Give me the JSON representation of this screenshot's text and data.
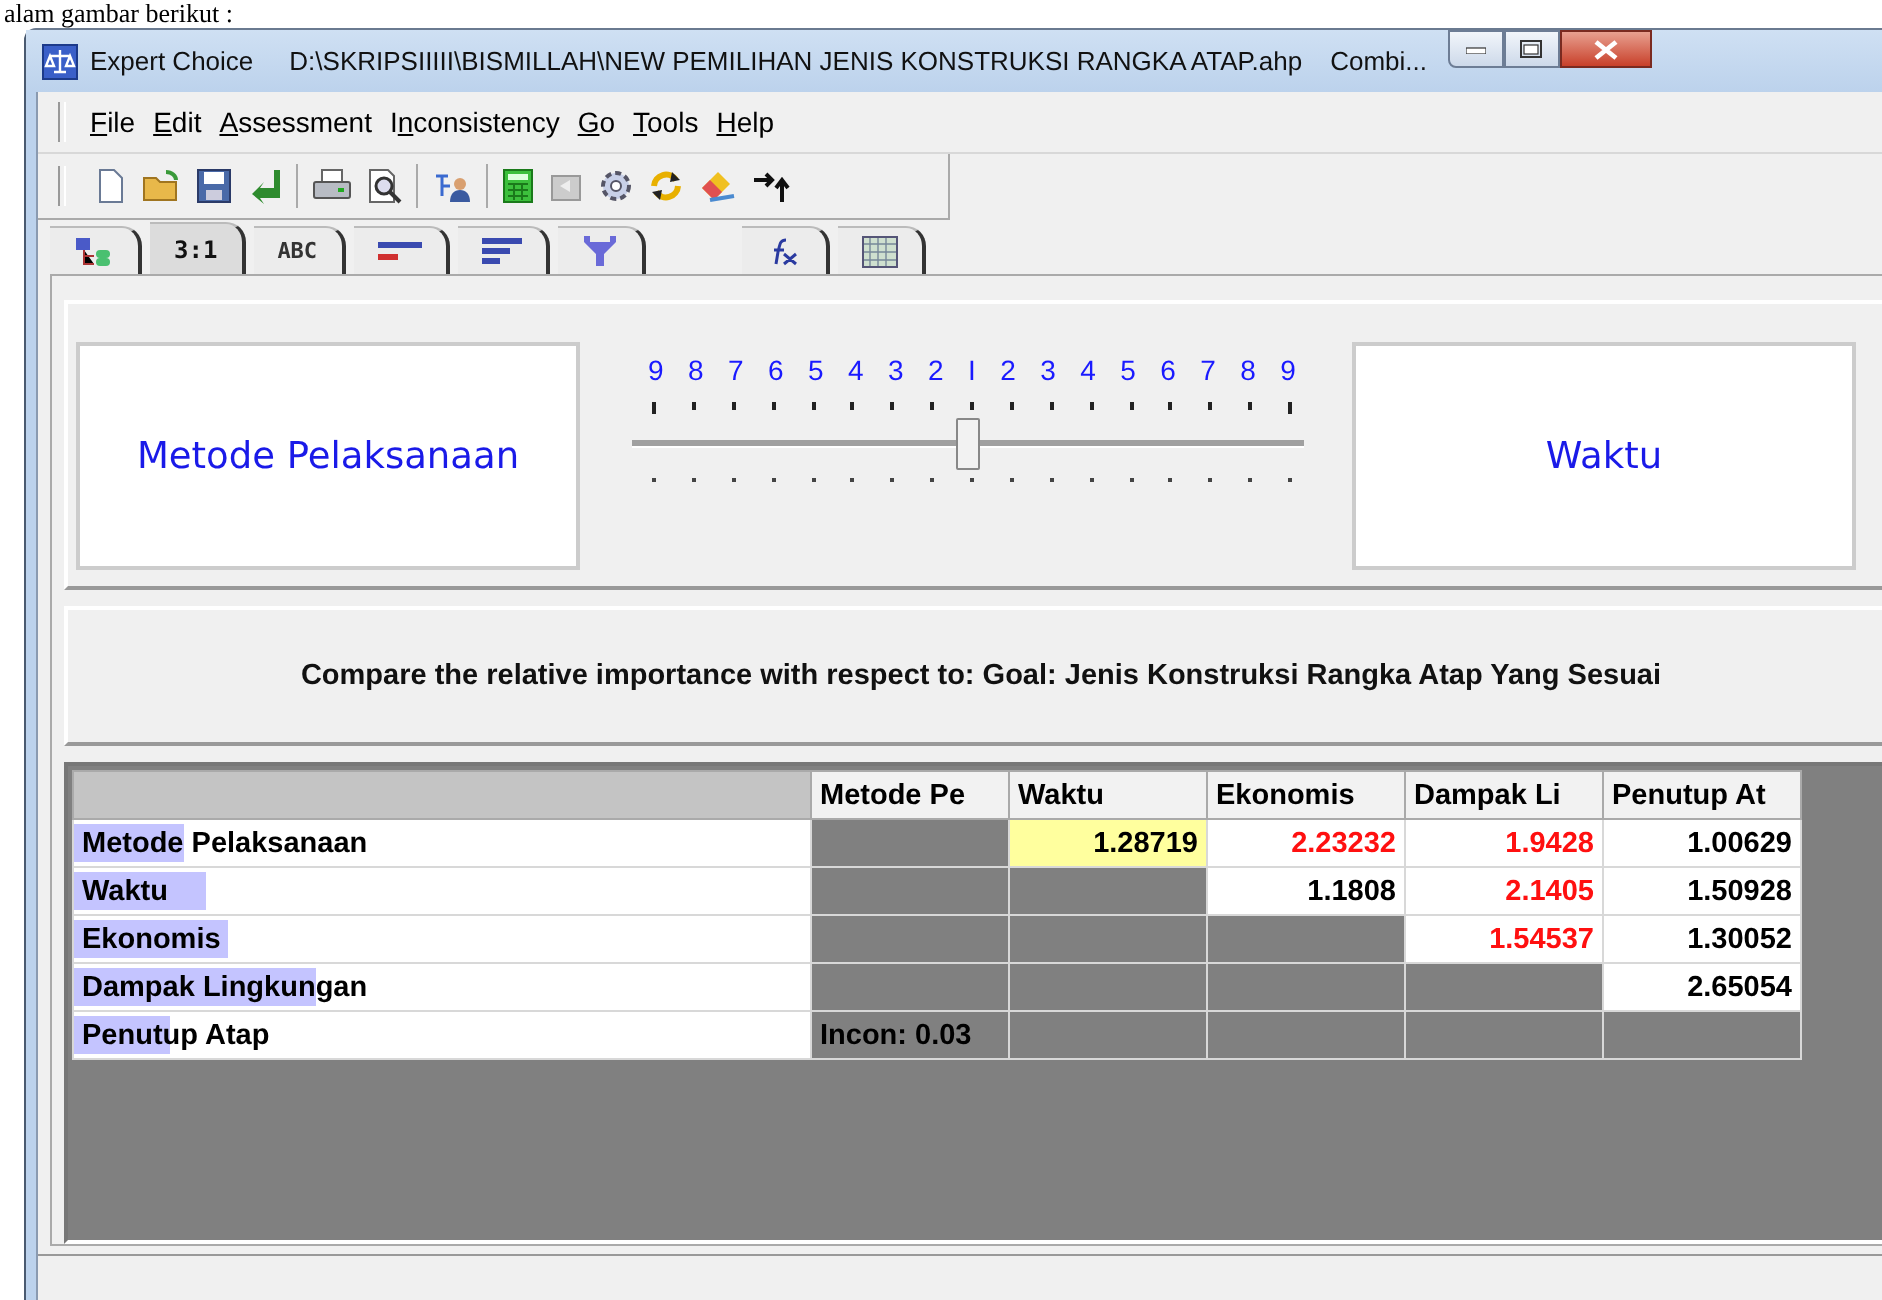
{
  "document_text": "alam gambar berikut :",
  "window": {
    "title": "Expert Choice",
    "path": "D:\\SKRIPSIIIII\\BISMILLAH\\NEW PEMILIHAN JENIS KONSTRUKSI RANGKA ATAP.ahp",
    "mode": "Combi..."
  },
  "menu": [
    {
      "key": "F",
      "rest": "ile"
    },
    {
      "key": "E",
      "rest": "dit"
    },
    {
      "key": "A",
      "rest": "ssessment"
    },
    {
      "lead": "I",
      "key": "n",
      "rest": "consistency"
    },
    {
      "key": "G",
      "rest": "o"
    },
    {
      "key": "T",
      "rest": "ools"
    },
    {
      "key": "H",
      "rest": "elp"
    }
  ],
  "tabs": [
    {
      "kind": "tree",
      "selected": false
    },
    {
      "kind": "text",
      "label": "3:1",
      "selected": true
    },
    {
      "kind": "text",
      "label": "ABC",
      "selected": false
    },
    {
      "kind": "bars-red",
      "selected": false
    },
    {
      "kind": "bars",
      "selected": false
    },
    {
      "kind": "funnel",
      "selected": false
    },
    {
      "kind": "formula",
      "selected": false
    },
    {
      "kind": "grid",
      "selected": false
    }
  ],
  "comparison": {
    "left": "Metode Pelaksanaan",
    "right": "Waktu",
    "scale": [
      "9",
      "8",
      "7",
      "6",
      "5",
      "4",
      "3",
      "2",
      "I",
      "2",
      "3",
      "4",
      "5",
      "6",
      "7",
      "8",
      "9"
    ],
    "level": 0.5
  },
  "prompt": "Compare the relative importance with respect to: Goal: Jenis Konstruksi Rangka Atap Yang Sesuai",
  "matrix": {
    "columns": [
      "Metode Pe",
      "Waktu",
      "Ekonomis",
      "Dampak Li",
      "Penutup At"
    ],
    "rows": [
      {
        "label": "Metode Pelaksanaan",
        "level": 0.15,
        "cells": [
          {
            "kind": "blank"
          },
          {
            "kind": "value",
            "value": "1.28719",
            "inverse": false,
            "selected": true
          },
          {
            "kind": "value",
            "value": "2.23232",
            "inverse": true,
            "selected": false
          },
          {
            "kind": "value",
            "value": "1.9428",
            "inverse": true,
            "selected": false
          },
          {
            "kind": "value",
            "value": "1.00629",
            "inverse": false,
            "selected": false
          }
        ]
      },
      {
        "label": "Waktu",
        "level": 0.18,
        "cells": [
          {
            "kind": "blank"
          },
          {
            "kind": "blank"
          },
          {
            "kind": "value",
            "value": "1.1808",
            "inverse": false,
            "selected": false
          },
          {
            "kind": "value",
            "value": "2.1405",
            "inverse": true,
            "selected": false
          },
          {
            "kind": "value",
            "value": "1.50928",
            "inverse": false,
            "selected": false
          }
        ]
      },
      {
        "label": "Ekonomis",
        "level": 0.21,
        "cells": [
          {
            "kind": "blank"
          },
          {
            "kind": "blank"
          },
          {
            "kind": "blank"
          },
          {
            "kind": "value",
            "value": "1.54537",
            "inverse": true,
            "selected": false
          },
          {
            "kind": "value",
            "value": "1.30052",
            "inverse": false,
            "selected": false
          }
        ]
      },
      {
        "label": "Dampak Lingkungan",
        "level": 0.33,
        "cells": [
          {
            "kind": "blank"
          },
          {
            "kind": "blank"
          },
          {
            "kind": "blank"
          },
          {
            "kind": "blank"
          },
          {
            "kind": "value",
            "value": "2.65054",
            "inverse": false,
            "selected": false
          }
        ]
      },
      {
        "label": "Penutup Atap",
        "level": 0.13,
        "cells": [
          {
            "kind": "note",
            "value": "Incon: 0.03"
          },
          {
            "kind": "blank"
          },
          {
            "kind": "blank"
          },
          {
            "kind": "blank"
          },
          {
            "kind": "blank"
          }
        ]
      }
    ]
  }
}
